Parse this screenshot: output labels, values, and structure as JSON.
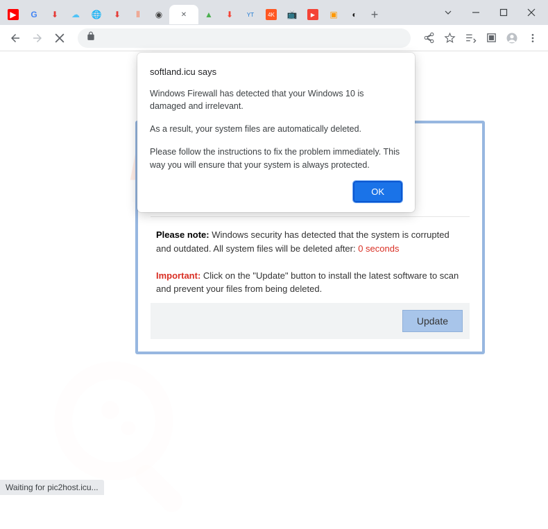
{
  "tabs": {
    "items": [
      {
        "icon": "▶",
        "color": "#ff0000"
      },
      {
        "icon": "G",
        "color": "#4285f4"
      },
      {
        "icon": "⬇",
        "color": "#e53935"
      },
      {
        "icon": "☁",
        "color": "#4fc3f7"
      },
      {
        "icon": "🌐",
        "color": "#616161"
      },
      {
        "icon": "⬇",
        "color": "#e53935"
      },
      {
        "icon": "⦀",
        "color": "#ff7043"
      },
      {
        "icon": "◉",
        "color": "#424242"
      },
      {
        "icon": "✕",
        "color": "#5f6368",
        "active": true
      },
      {
        "icon": "▲",
        "color": "#4caf50"
      },
      {
        "icon": "⬇",
        "color": "#f44336"
      },
      {
        "icon": "YT",
        "color": "#1976d2"
      },
      {
        "icon": "4K",
        "color": "#ff5722"
      },
      {
        "icon": "📺",
        "color": "#3f51b5"
      },
      {
        "icon": "▶",
        "color": "#f44336"
      },
      {
        "icon": "▣",
        "color": "#ff9800"
      },
      {
        "icon": "◐",
        "color": "#212121"
      }
    ],
    "new_tab": "+"
  },
  "toolbar": {
    "back": "←",
    "forward": "→",
    "stop": "✕",
    "lock": "🔒"
  },
  "js_dialog": {
    "title": "softland.icu says",
    "msg1": "Windows Firewall has detected that your Windows 10 is damaged and irrelevant.",
    "msg2": "As a result, your system files are automatically deleted.",
    "msg3": "Please follow the instructions to fix the problem immediately. This way you will ensure that your system is always protected.",
    "ok_label": "OK"
  },
  "scam": {
    "note_label": "Please note:",
    "note_text": " Windows security has detected that the system is corrupted and outdated. All system files will be deleted after: ",
    "countdown": "0 seconds",
    "important_label": "Important:",
    "important_text": " Click on the \"Update\" button to install the latest software to scan and prevent your files from being deleted.",
    "update_label": "Update"
  },
  "statusbar": {
    "text": "Waiting for pic2host.icu..."
  },
  "watermark": {
    "text": "pcrisk.com"
  }
}
